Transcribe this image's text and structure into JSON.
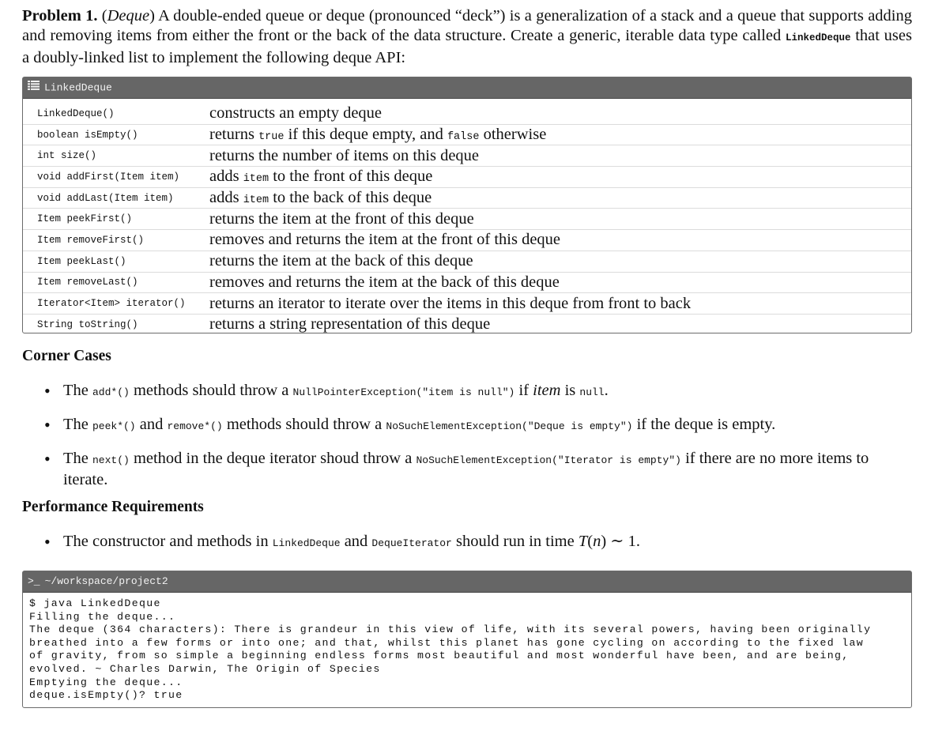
{
  "intro": {
    "problem_label": "Problem 1.",
    "topic": "Deque",
    "text_1": " A double-ended queue or deque (pronounced “deck”) is a generalization of a stack and a queue that supports adding and removing items from either the front or the back of the data structure. Create a generic, iterable data type called ",
    "class_name": "LinkedDeque",
    "text_2": " that uses a doubly-linked list to implement the following deque API:"
  },
  "api_box": {
    "icon": "list-icon",
    "title": "LinkedDeque",
    "rows": [
      {
        "signature": "LinkedDeque()",
        "desc": [
          {
            "t": "constructs an empty deque"
          }
        ]
      },
      {
        "signature": "boolean isEmpty()",
        "desc": [
          {
            "t": "returns "
          },
          {
            "c": "true"
          },
          {
            "t": " if this deque empty, and "
          },
          {
            "c": "false"
          },
          {
            "t": " otherwise"
          }
        ]
      },
      {
        "signature": "int size()",
        "desc": [
          {
            "t": "returns the number of items on this deque"
          }
        ]
      },
      {
        "signature": "void addFirst(Item item)",
        "desc": [
          {
            "t": "adds "
          },
          {
            "c": "item"
          },
          {
            "t": " to the front of this deque"
          }
        ]
      },
      {
        "signature": "void addLast(Item item)",
        "desc": [
          {
            "t": "adds "
          },
          {
            "c": "item"
          },
          {
            "t": " to the back of this deque"
          }
        ]
      },
      {
        "signature": "Item peekFirst()",
        "desc": [
          {
            "t": "returns the item at the front of this deque"
          }
        ]
      },
      {
        "signature": "Item removeFirst()",
        "desc": [
          {
            "t": "removes and returns the item at the front of this deque"
          }
        ]
      },
      {
        "signature": "Item peekLast()",
        "desc": [
          {
            "t": "returns the item at the back of this deque"
          }
        ]
      },
      {
        "signature": "Item removeLast()",
        "desc": [
          {
            "t": "removes and returns the item at the back of this deque"
          }
        ]
      },
      {
        "signature": "Iterator<Item> iterator()",
        "desc": [
          {
            "t": "returns an iterator to iterate over the items in this deque from front to back"
          }
        ]
      },
      {
        "signature": "String toString()",
        "desc": [
          {
            "t": "returns a string representation of this deque"
          }
        ]
      }
    ]
  },
  "corner_cases": {
    "heading": "Corner Cases",
    "items": [
      [
        {
          "t": "The "
        },
        {
          "c": "add*()"
        },
        {
          "t": " methods should throw a "
        },
        {
          "c": "NullPointerException(\"item is null\")"
        },
        {
          "t": " if "
        },
        {
          "i": "item"
        },
        {
          "t": " is "
        },
        {
          "c": "null"
        },
        {
          "t": "."
        }
      ],
      [
        {
          "t": "The "
        },
        {
          "c": "peek*()"
        },
        {
          "t": " and "
        },
        {
          "c": "remove*()"
        },
        {
          "t": " methods should throw a "
        },
        {
          "c": "NoSuchElementException(\"Deque is empty\")"
        },
        {
          "t": " if the deque is empty."
        }
      ],
      [
        {
          "t": "The "
        },
        {
          "c": "next()"
        },
        {
          "t": " method in the deque iterator shoud throw a "
        },
        {
          "c": "NoSuchElementException(\"Iterator is empty\")"
        },
        {
          "t": " if there are no more items to iterate."
        }
      ]
    ]
  },
  "performance": {
    "heading": "Performance Requirements",
    "items": [
      [
        {
          "t": "The constructor and methods in "
        },
        {
          "c": "LinkedDeque"
        },
        {
          "t": " and "
        },
        {
          "c": "DequeIterator"
        },
        {
          "t": " should run in time "
        },
        {
          "i": "T"
        },
        {
          "t": "("
        },
        {
          "i": "n"
        },
        {
          "t": ") ∼ 1."
        }
      ]
    ]
  },
  "terminal": {
    "icon": "terminal-prompt-icon",
    "icon_glyph": ">_",
    "path": "~/workspace/project2",
    "lines": [
      "$ java LinkedDeque",
      "Filling the deque...",
      "The deque (364 characters): There is grandeur in this view of life, with its several powers, having been originally",
      "breathed into a few forms or into one; and that, whilst this planet has gone cycling on according to the fixed law",
      "of gravity, from so simple a beginning endless forms most beautiful and most wonderful have been, and are being,",
      "evolved. ~ Charles Darwin, The Origin of Species",
      "Emptying the deque...",
      "deque.isEmpty()? true"
    ]
  }
}
